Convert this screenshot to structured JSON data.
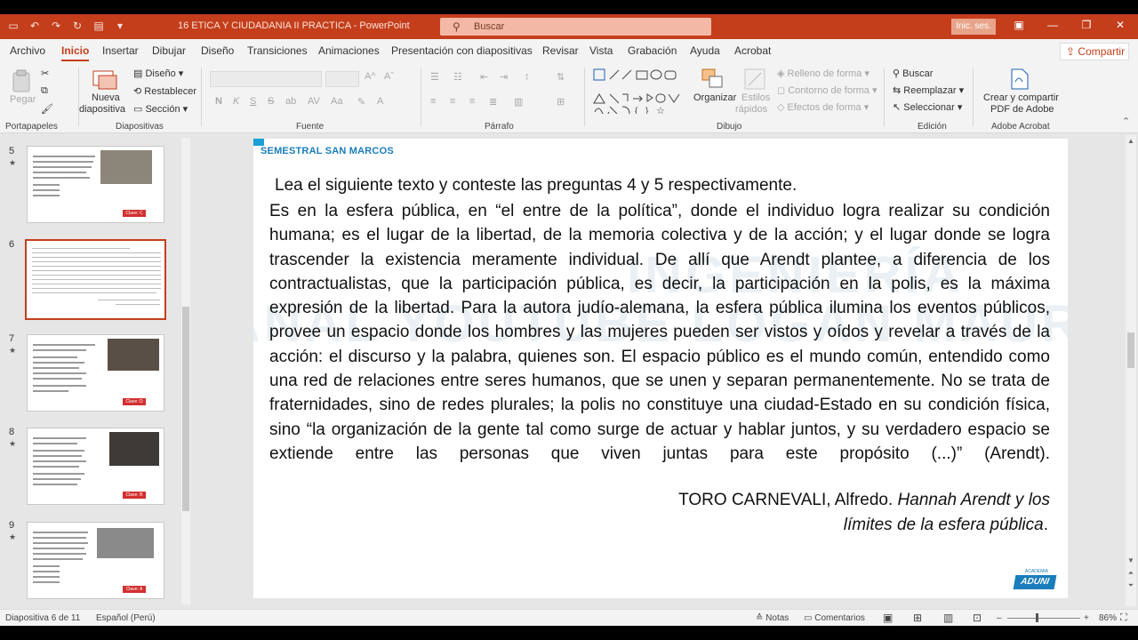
{
  "titlebar": {
    "doc_title": "16 ETICA Y CIUDADANIA II PRACTICA",
    "separator": "-",
    "app_name": "PowerPoint",
    "search_placeholder": "Buscar",
    "signin_label": "Inic. ses.",
    "accent_color": "#c43e1c"
  },
  "tabs": [
    "Archivo",
    "Inicio",
    "Insertar",
    "Dibujar",
    "Diseño",
    "Transiciones",
    "Animaciones",
    "Presentación con diapositivas",
    "Revisar",
    "Vista",
    "Grabación",
    "Ayuda",
    "Acrobat"
  ],
  "active_tab": "Inicio",
  "share_label": "Compartir",
  "ribbon": {
    "portapapeles": {
      "paste": "Pegar",
      "label": "Portapapeles"
    },
    "diapositivas": {
      "new_slide_1": "Nueva",
      "new_slide_2": "diapositiva",
      "layout": "Diseño",
      "reset": "Restablecer",
      "section": "Sección",
      "label": "Diapositivas"
    },
    "fuente": {
      "label": "Fuente",
      "bold": "N",
      "italic": "K",
      "underline": "S",
      "strike": "S"
    },
    "parrafo": {
      "label": "Párrafo"
    },
    "dibujo": {
      "arrange_1": "Organizar",
      "styles_1": "Estilos",
      "styles_2": "rápidos",
      "fill": "Relleno de forma",
      "outline": "Contorno de forma",
      "effects": "Efectos de forma",
      "label": "Dibujo"
    },
    "edicion": {
      "find": "Buscar",
      "replace": "Reemplazar",
      "select": "Seleccionar",
      "label": "Edición"
    },
    "acrobat": {
      "create_1": "Crear y compartir",
      "create_2": "PDF de Adobe",
      "label": "Adobe Acrobat"
    }
  },
  "thumbnails": [
    {
      "num": "5",
      "star": "★",
      "tag": "Clave: C"
    },
    {
      "num": "6",
      "star": "",
      "tag": ""
    },
    {
      "num": "7",
      "star": "★",
      "tag": "Clave: D"
    },
    {
      "num": "8",
      "star": "★",
      "tag": "Clave: B"
    },
    {
      "num": "9",
      "star": "★",
      "tag": "Clave: A"
    }
  ],
  "slide": {
    "brand": "SEMESTRAL SAN MARCOS",
    "watermark_1": "INGENIERÍA",
    "watermark_2": "CANAL YOUTUBE LOGAN MAURUS",
    "heading": "Lea el siguiente texto y conteste las preguntas 4 y 5 respectivamente.",
    "body": "Es en la esfera pública, en “el entre de la política”, donde el individuo logra realizar su condición humana; es el lugar de la libertad, de la memoria colectiva y de la acción; y el lugar donde se logra trascender la existencia meramente individual. De allí que Arendt plantee, a diferencia de los contractualistas, que la participación pública, es decir, la participación en la polis, es la máxima expresión de la libertad. Para la autora judío-alemana, la esfera pública ilumina los eventos públicos, provee un espacio donde los hombres y las mujeres pueden ser vistos y oídos y revelar a través de la acción: el discurso y la palabra, quienes son. El espacio público es el mundo común, entendido como una red de relaciones entre seres humanos, que se unen y separan permanentemente. No se trata de fraternidades, sino de redes plurales; la polis no constituye una ciudad-Estado en su condición física, sino “la organización de la gente tal como surge de actuar y hablar juntos, y su verdadero espacio se extiende entre las personas que viven juntas para este propósito (...)” (Arendt).",
    "citation_author": "TORO CARNEVALI, Alfredo.",
    "citation_title_1": "Hannah Arendt y los",
    "citation_title_2": "límites de la esfera pública",
    "citation_end": ".",
    "logo": "ADUNI",
    "logo_small": "ACADEMIA"
  },
  "status": {
    "slide_counter": "Diapositiva 6 de 11",
    "language": "Español (Perú)",
    "notes": "Notas",
    "comments": "Comentarios",
    "zoom": "86%",
    "zoom_minus": "–",
    "zoom_plus": "+"
  }
}
